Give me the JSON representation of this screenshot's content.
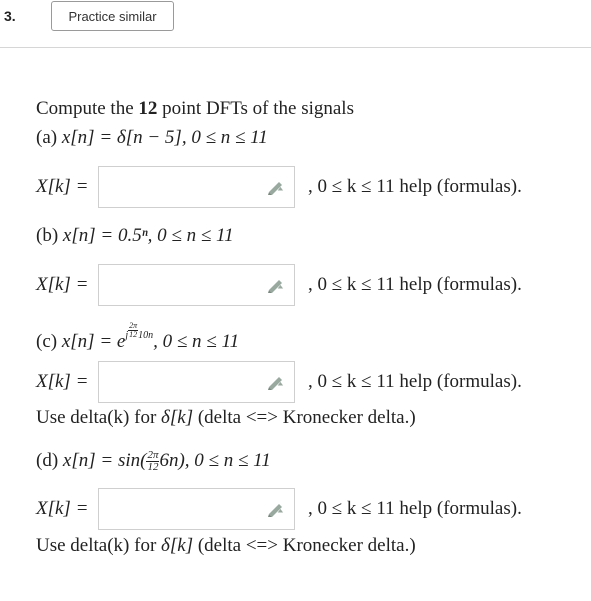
{
  "question": {
    "number": "3.",
    "practice_button": "Practice similar"
  },
  "prompt": {
    "intro_pre": "Compute the ",
    "intro_n": "12",
    "intro_post": " point DFTs of the signals"
  },
  "parts": [
    {
      "label": "(a)",
      "lhs": "x[n] = δ[n − 5], 0 ≤ n ≤ 11",
      "answer_value": ""
    },
    {
      "label": "(b)",
      "lhs": "x[n] = 0.5ⁿ, 0 ≤ n ≤ 11",
      "answer_value": ""
    },
    {
      "label": "(c)",
      "lhs_pre": "x[n] = e",
      "exp_j": "j",
      "exp_num": "2π",
      "exp_den": "12",
      "exp_post": "10n",
      "lhs_post": ", 0 ≤ n ≤ 11",
      "answer_value": ""
    },
    {
      "label": "(d)",
      "lhs_pre": "x[n] = sin(",
      "frac_num": "2π",
      "frac_den": "12",
      "lhs_post": "6n), 0 ≤ n ≤ 11",
      "answer_value": ""
    }
  ],
  "answer": {
    "lhs": "X[k] =",
    "range": ", 0 ≤ k ≤ 11",
    "help_link": "help (formulas)",
    "help_end": "."
  },
  "note": {
    "text1": "Use delta(k) for ",
    "symbol": "δ[k]",
    "text2": " (delta <=> Kronecker delta.)"
  },
  "icons": {
    "pencil": "pencil-icon",
    "pencil_color": "#9aa9a0"
  }
}
